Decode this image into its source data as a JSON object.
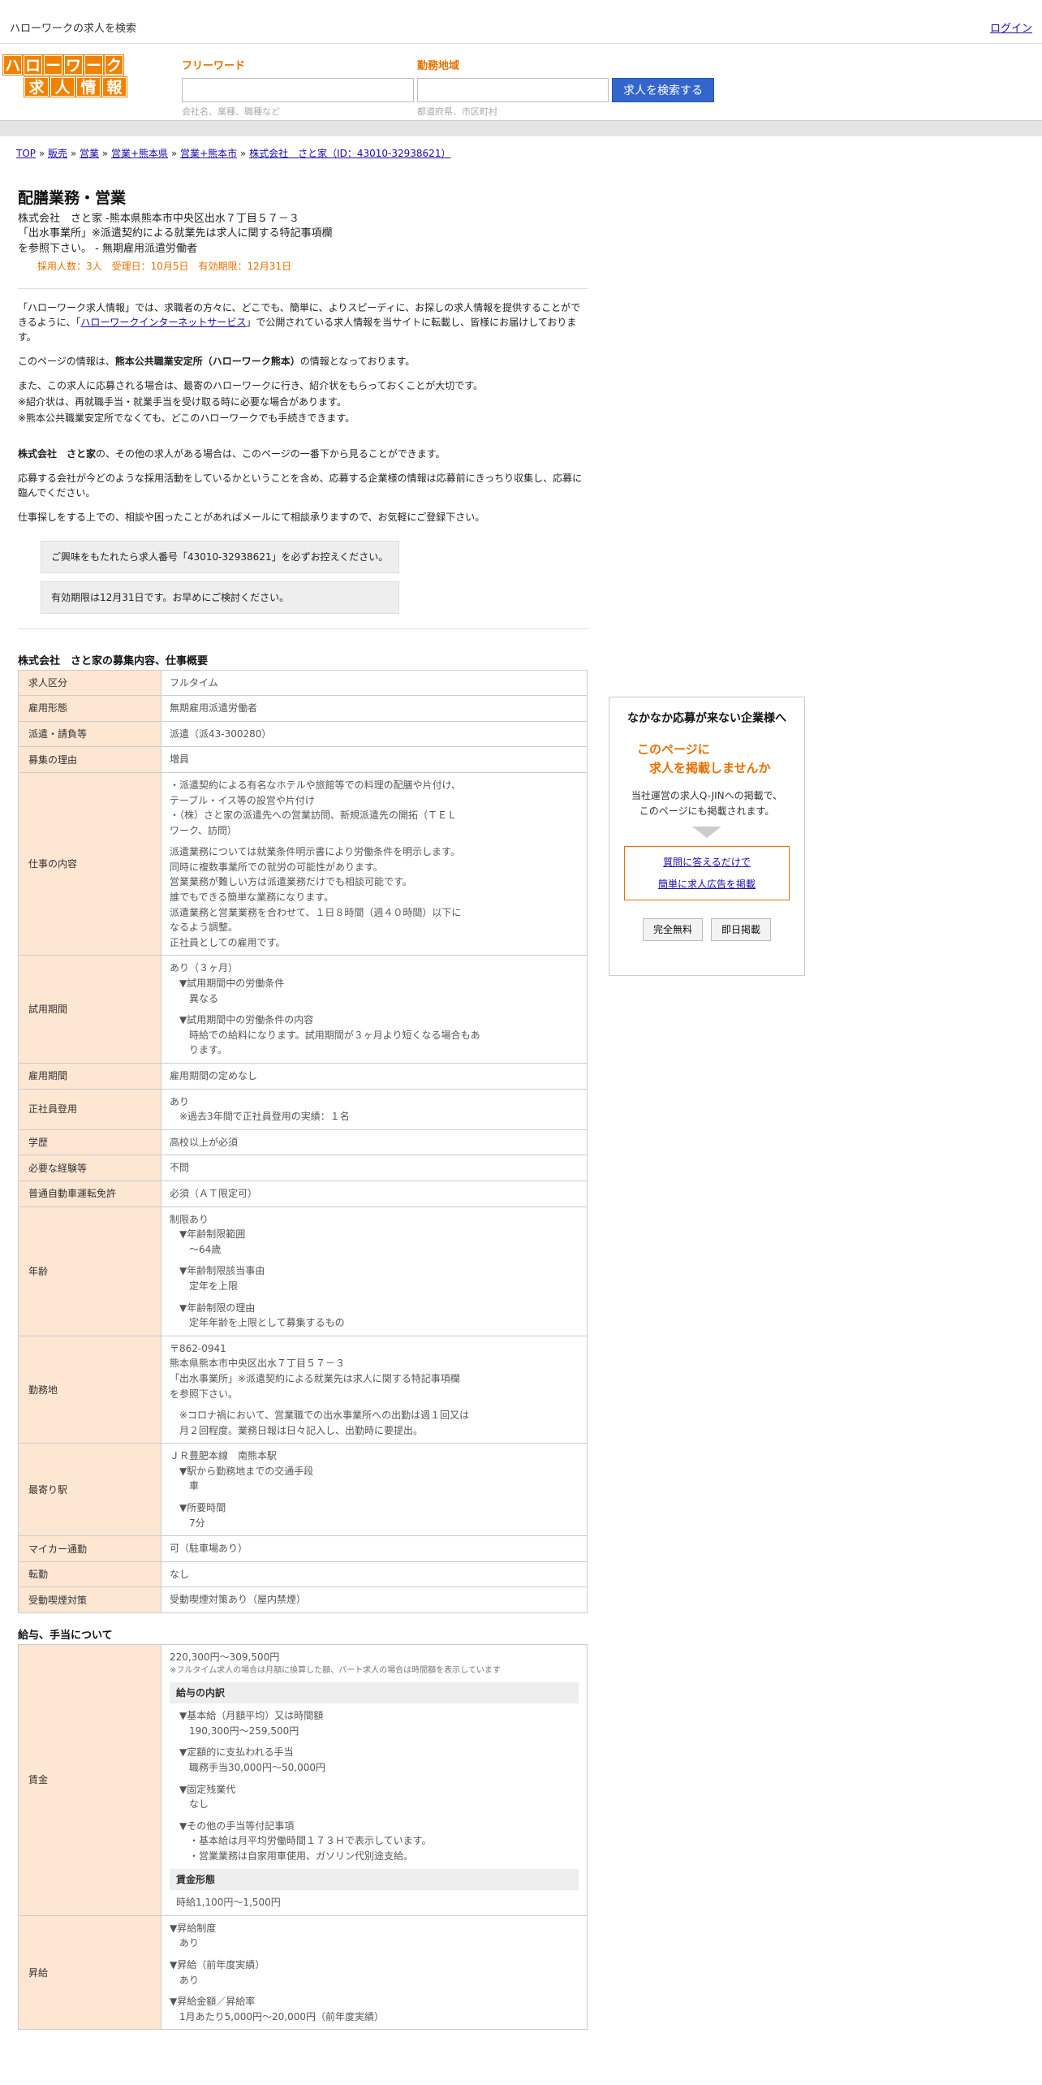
{
  "topbar": {
    "title": "ハローワークの求人を検索",
    "login": "ログイン"
  },
  "logo": {
    "row1": [
      "ハ",
      "ロ",
      "ー",
      "ワ",
      "ー",
      "ク"
    ],
    "row2": [
      "求",
      "人",
      "情",
      "報"
    ]
  },
  "search": {
    "freeword_label": "フリーワード",
    "freeword_placeholder": "会社名、業種、職種など",
    "area_label": "勤務地域",
    "area_placeholder": "都道府県、市区町村",
    "button": "求人を検索する"
  },
  "breadcrumb": {
    "items": [
      "TOP",
      "販売",
      "営業",
      "営業+熊本県",
      "営業+熊本市",
      "株式会社　さと家（ID：43010-32938621）"
    ]
  },
  "job": {
    "title": "配膳業務・営業",
    "line1": "株式会社　さと家 -熊本県熊本市中央区出水７丁目５７－３",
    "line2": "「出水事業所」※派遣契約による就業先は求人に関する特記事項欄",
    "line3": "を参照下さい。 - 無期雇用派遣労働者",
    "meta": "採用人数：3人　受理日：10月5日　有効期限：12月31日"
  },
  "intro": {
    "p1a": "「ハローワーク求人情報」では、求職者の方々に、どこでも、簡単に、よりスピーディに、お探しの求人情報を提供することができるように、「",
    "p1link": "ハローワークインターネットサービス",
    "p1b": "」で公開されている求人情報を当サイトに転載し、皆様にお届けしております。",
    "p2a": "このページの情報は、",
    "p2b": "熊本公共職業安定所（ハローワーク熊本）",
    "p2c": "の情報となっております。",
    "p3": "また、この求人に応募される場合は、最寄のハローワークに行き、紹介状をもらっておくことが大切です。",
    "p4": "※紹介状は、再就職手当・就業手当を受け取る時に必要な場合があります。",
    "p5": "※熊本公共職業安定所でなくても、どこのハローワークでも手続きできます。",
    "p6a": "株式会社　さと家",
    "p6b": "の、その他の求人がある場合は、このページの一番下から見ることができます。",
    "p7": "応募する会社が今どのような採用活動をしているかということを含め、応募する企業様の情報は応募前にきっちり収集し、応募に臨んでください。",
    "p8": "仕事探しをする上での、相談や困ったことがあればメールにて相談承りますので、お気軽にご登録下さい。",
    "note1": "ご興味をもたれたら求人番号「43010-32938621」を必ずお控えください。",
    "note2": "有効期限は12月31日です。お早めにご検討ください。"
  },
  "overview": {
    "title": "株式会社　さと家の募集内容、仕事概要",
    "kubun_h": "求人区分",
    "kubun": "フルタイム",
    "keitai_h": "雇用形態",
    "keitai": "無期雇用派遣労働者",
    "haken_h": "派遣・請負等",
    "haken": "派遣（派43-300280）",
    "riyu_h": "募集の理由",
    "riyu": "増員",
    "naiyo_h": "仕事の内容",
    "naiyo": [
      "・派遣契約による有名なホテルや旅館等での料理の配膳や片付け、",
      "テーブル・イス等の設営や片付け",
      "・（株）さと家の派遣先への営業訪問、新規派遣先の開拓（ＴＥＬ",
      "ワーク、訪問）",
      "",
      "派遣業務については就業条件明示書により労働条件を明示します。",
      "同時に複数事業所での就労の可能性があります。",
      "営業業務が難しい方は派遣業務だけでも相談可能です。",
      "誰でもできる簡単な業務になります。",
      "派遣業務と営業業務を合わせて、１日８時間（週４０時間）以下に",
      "なるよう調整。",
      "正社員としての雇用です。"
    ],
    "shiyo_h": "試用期間",
    "shiyo_a": "あり（３ヶ月）",
    "shiyo_b": "▼試用期間中の労働条件",
    "shiyo_c": "異なる",
    "shiyo_d": "▼試用期間中の労働条件の内容",
    "shiyo_e": "時給での給料になります。試用期間が３ヶ月より短くなる場合もあ",
    "shiyo_f": "ります。",
    "kikan_h": "雇用期間",
    "kikan": "雇用期間の定めなし",
    "seishain_h": "正社員登用",
    "seishain_a": "あり",
    "seishain_b": "※過去3年間で正社員登用の実績：１名",
    "gakureki_h": "学歴",
    "gakureki": "高校以上が必須",
    "keiken_h": "必要な経験等",
    "keiken": "不問",
    "menkyo_h": "普通自動車運転免許",
    "menkyo": "必須（ＡＴ限定可）",
    "nenrei_h": "年齢",
    "nenrei_a": "制限あり",
    "nenrei_b": "▼年齢制限範囲",
    "nenrei_c": "〜64歳",
    "nenrei_d": "▼年齢制限該当事由",
    "nenrei_e": "定年を上限",
    "nenrei_f": "▼年齢制限の理由",
    "nenrei_g": "定年年齢を上限として募集するもの",
    "kinmu_h": "勤務地",
    "kinmu_a": "〒862-0941",
    "kinmu_b": "熊本県熊本市中央区出水７丁目５７－３",
    "kinmu_c": "「出水事業所」※派遣契約による就業先は求人に関する特記事項欄",
    "kinmu_d": "を参照下さい。",
    "kinmu_e": "※コロナ禍において、営業職での出水事業所への出勤は週１回又は",
    "kinmu_f": "月２回程度。業務日報は日々記入し、出勤時に要提出。",
    "eki_h": "最寄り駅",
    "eki_a": "ＪＲ豊肥本線　南熊本駅",
    "eki_b": "▼駅から勤務地までの交通手段",
    "eki_c": "車",
    "eki_d": "▼所要時間",
    "eki_e": "7分",
    "mycar_h": "マイカー通勤",
    "mycar": "可（駐車場あり）",
    "tenkin_h": "転勤",
    "tenkin": "なし",
    "kitsuen_h": "受動喫煙対策",
    "kitsuen": "受動喫煙対策あり（屋内禁煙）"
  },
  "salary": {
    "title": "給与、手当について",
    "chingin_h": "賃金",
    "range": "220,300円〜309,500円",
    "range_note": "※フルタイム求人の場合は月額に換算した額、パート求人の場合は時間額を表示しています",
    "uchiwake": "給与の内訳",
    "kihon_a": "▼基本給（月額平均）又は時間額",
    "kihon_b": "190,300円〜259,500円",
    "teigaku_a": "▼定額的に支払われる手当",
    "teigaku_b": "職務手当30,000円〜50,000円",
    "kotei_a": "▼固定残業代",
    "kotei_b": "なし",
    "sonota_a": "▼その他の手当等付記事項",
    "sonota_b": "・基本給は月平均労働時間１７３Ｈで表示しています。",
    "sonota_c": "・営業業務は自家用車使用、ガソリン代別途支給。",
    "keitai": "賃金形態",
    "keitai_val": "時給1,100円〜1,500円",
    "shokyu_h": "昇給",
    "shokyu_a": "▼昇給制度",
    "shokyu_b": "あり",
    "shokyu_c": "▼昇給（前年度実績）",
    "shokyu_d": "あり",
    "shokyu_e": "▼昇給金額／昇給率",
    "shokyu_f": "1月あたり5,000円〜20,000円（前年度実績）"
  },
  "side": {
    "title": "なかなか応募が来ない企業様へ",
    "hl1": "このページに",
    "hl2": "　求人を掲載しませんか",
    "desc1": "当社運営の求人Q-JINへの掲載で、",
    "desc2": "このページにも掲載されます。",
    "link1": "質問に答えるだけで",
    "link2": "簡単に求人広告を掲載",
    "btn1": "完全無料",
    "btn2": "即日掲載"
  }
}
